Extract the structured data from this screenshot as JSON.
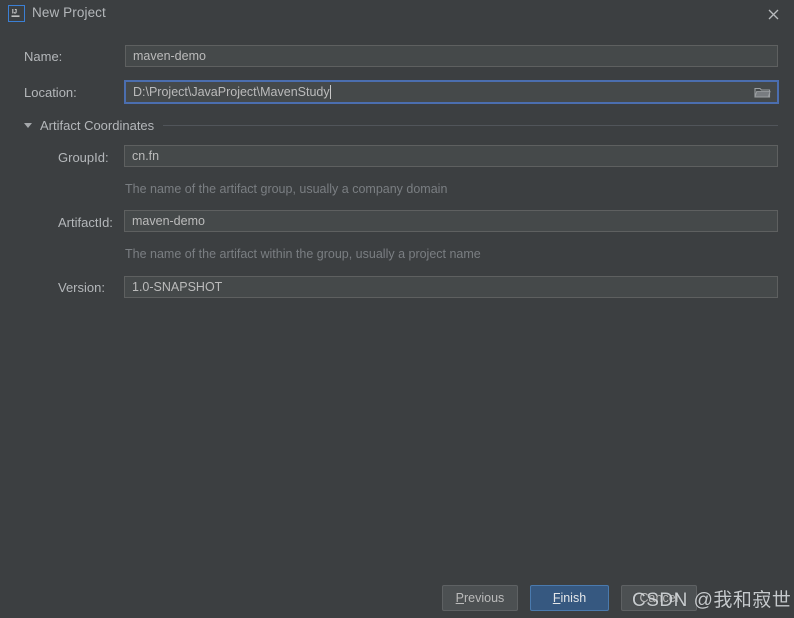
{
  "window": {
    "title": "New Project",
    "app_icon": "intellij-idea-icon",
    "close_icon": "close-icon"
  },
  "form": {
    "name": {
      "label": "Name:",
      "value": "maven-demo",
      "placeholder": ""
    },
    "location": {
      "label": "Location:",
      "value": "D:\\Project\\JavaProject\\MavenStudy",
      "placeholder": "",
      "browse_icon": "folder-icon"
    }
  },
  "artifact_section": {
    "title": "Artifact Coordinates",
    "expanded": true,
    "toggle_icon": "chevron-down-icon",
    "group_id": {
      "label": "GroupId:",
      "value": "cn.fn",
      "hint": "The name of the artifact group, usually a company domain"
    },
    "artifact_id": {
      "label": "ArtifactId:",
      "value": "maven-demo",
      "hint": "The name of the artifact within the group, usually a project name"
    },
    "version": {
      "label": "Version:",
      "value": "1.0-SNAPSHOT",
      "hint": ""
    }
  },
  "buttons": {
    "previous": {
      "label": "Previous",
      "mnemonic": "P",
      "primary": false
    },
    "finish": {
      "label": "Finish",
      "mnemonic": "F",
      "primary": true
    },
    "cancel": {
      "label": "Cancel",
      "mnemonic": "",
      "primary": false
    }
  },
  "watermark": {
    "text": "CSDN @我和寂世"
  },
  "colors": {
    "background": "#3c3f41",
    "field_background": "#45494a",
    "field_border": "#5e6060",
    "focus_border": "#4b6eaf",
    "primary_button": "#365880",
    "text": "#bbbbbb",
    "hint_text": "#7a7e82"
  }
}
